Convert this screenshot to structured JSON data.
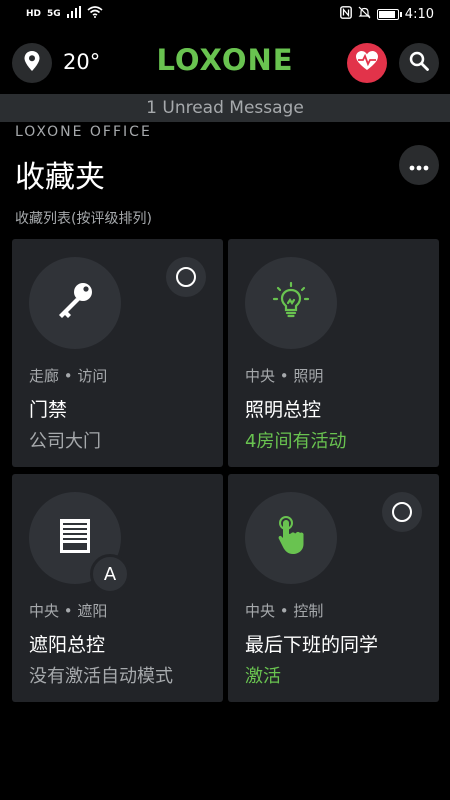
{
  "status_bar": {
    "left_icons": [
      "HD",
      "5G",
      "signal-icon",
      "wifi-icon"
    ],
    "hd": "HD",
    "net": "5G",
    "time": "4:10",
    "battery_level": 0.9
  },
  "header": {
    "temperature": "20°",
    "logo": "LOXONE"
  },
  "message_bar": {
    "text": "1 Unread Message"
  },
  "page": {
    "overline": "LOXONE OFFICE",
    "title": "收藏夹",
    "subtitle": "收藏列表(按评级排列)"
  },
  "cards": [
    {
      "meta": "走廊 • 访问",
      "name": "门禁",
      "status": "公司大门",
      "icon": "key-icon",
      "active": false
    },
    {
      "meta": "中央 • 照明",
      "name": "照明总控",
      "status": "4房间有活动",
      "icon": "lightbulb-icon",
      "active": true
    },
    {
      "meta": "中央 • 遮阳",
      "name": "遮阳总控",
      "status": "没有激活自动模式",
      "icon": "blinds-icon",
      "badge": "A",
      "active": false
    },
    {
      "meta": "中央 • 控制",
      "name": "最后下班的同学",
      "status": "激活",
      "icon": "touch-hand-icon",
      "active": true
    }
  ],
  "colors": {
    "accent_green": "#69c350",
    "health_red": "#e2334a",
    "card_bg": "#222428",
    "icon_bg": "#303338",
    "text_muted": "#a6a9ac"
  }
}
